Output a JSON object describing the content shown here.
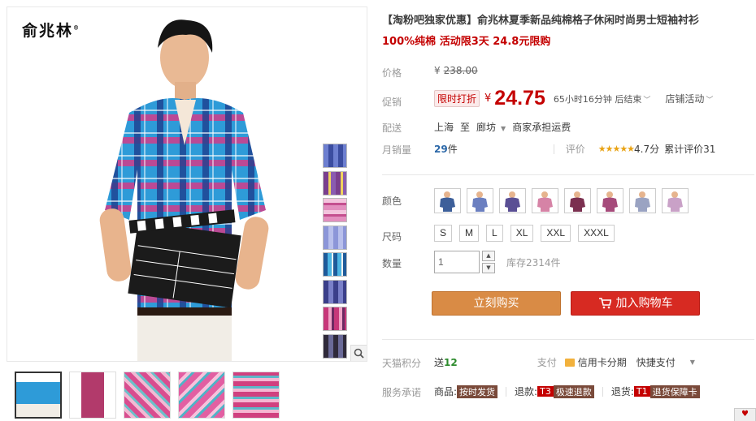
{
  "brand": {
    "logo_text": "俞兆林",
    "mark": "®"
  },
  "product": {
    "title": "【淘粉吧独家优惠】俞兆林夏季新品纯棉格子休闲时尚男士短袖衬衫",
    "subtitle": "100%纯棉 活动限3天 24.8元限购"
  },
  "price": {
    "label": "价格",
    "currency": "¥",
    "original": "238.00"
  },
  "promo": {
    "label": "促销",
    "tag": "限时打折",
    "currency": "¥",
    "price": "24.75",
    "countdown": "65小时16分钟 后结束",
    "shop_activity": "店铺活动"
  },
  "shipping": {
    "label": "配送",
    "from": "上海",
    "to_word": "至",
    "dest": "廊坊",
    "fee": "商家承担运费"
  },
  "sales": {
    "label": "月销量",
    "count": "29",
    "unit": "件",
    "review_label": "评价",
    "stars": "★★★★★",
    "score": "4.7分",
    "total_reviews": "累计评价31"
  },
  "color": {
    "label": "颜色",
    "options": [
      {
        "name": "blue-navy",
        "fill": "#3d5f9a"
      },
      {
        "name": "blue-light",
        "fill": "#6b7fc0"
      },
      {
        "name": "blue-purple",
        "fill": "#5a4f94"
      },
      {
        "name": "pink",
        "fill": "#d683a6"
      },
      {
        "name": "red-purple",
        "fill": "#7b3050"
      },
      {
        "name": "magenta",
        "fill": "#a64b7b"
      },
      {
        "name": "grey-blue",
        "fill": "#9aa3c2"
      },
      {
        "name": "lavender",
        "fill": "#c9a1c7"
      }
    ]
  },
  "size": {
    "label": "尺码",
    "options": [
      "S",
      "M",
      "L",
      "XL",
      "XXL",
      "XXXL"
    ]
  },
  "quantity": {
    "label": "数量",
    "value": "1",
    "stock": "库存2314件"
  },
  "actions": {
    "buy_now": "立刻购买",
    "add_to_cart": "加入购物车"
  },
  "points": {
    "label": "天猫积分",
    "give_word": "送",
    "value": "12",
    "pay_label": "支付",
    "credit_card": "信用卡分期",
    "quick_pay": "快捷支付"
  },
  "service": {
    "label": "服务承诺",
    "goods_word": "商品:",
    "goods_tag": "按时发货",
    "refund_word": "退款:",
    "refund_prefix": "T3",
    "refund_tag": "极速退款",
    "return_word": "退货:",
    "return_prefix": "T1",
    "return_tag": "退货保障卡"
  },
  "corner_badge": "♥",
  "colors": {
    "promo_red": "#c40000",
    "buy_orange": "#d98b45",
    "cart_red": "#d72a22"
  }
}
